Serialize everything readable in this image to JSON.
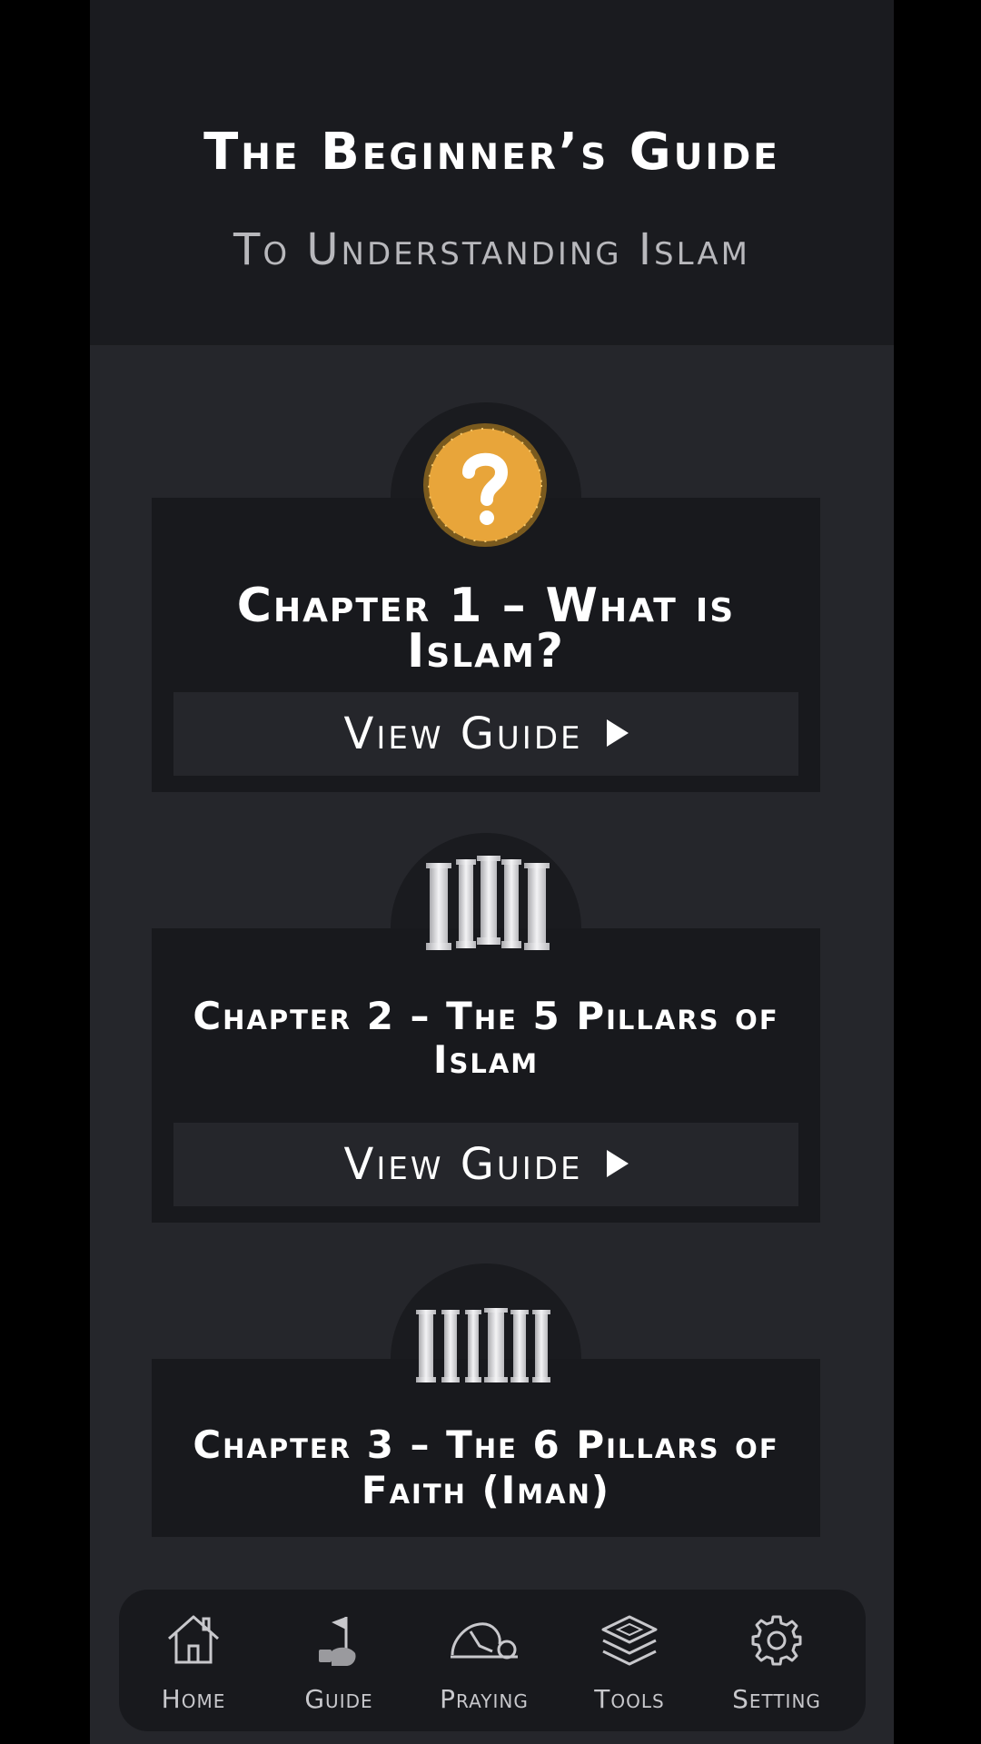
{
  "header": {
    "title": "The Beginner’s Guide",
    "subtitle": "To Understanding Islam"
  },
  "chapters": [
    {
      "title": "Chapter 1 – What is Islam?",
      "button_label": "View Guide",
      "icon": "question-mark-coin-icon"
    },
    {
      "title_line1": "Chapter 2 – The 5 Pillars of",
      "title_line2": "Islam",
      "button_label": "View Guide",
      "icon": "five-pillars-icon"
    },
    {
      "title_line1": "Chapter 3 – The 6 Pillars of",
      "title_line2": "Faith (Iman)",
      "icon": "six-pillars-icon"
    }
  ],
  "tabbar": {
    "items": [
      {
        "label": "Home",
        "icon": "home-icon"
      },
      {
        "label": "Guide",
        "icon": "guide-icon"
      },
      {
        "label": "Praying",
        "icon": "praying-icon"
      },
      {
        "label": "Tools",
        "icon": "tools-layers-icon"
      },
      {
        "label": "Setting",
        "icon": "gear-icon"
      }
    ]
  },
  "colors": {
    "background": "#25262b",
    "card": "#18191d",
    "header": "#1a1b1f",
    "accent_gold": "#e8a53a",
    "text": "#ffffff"
  }
}
